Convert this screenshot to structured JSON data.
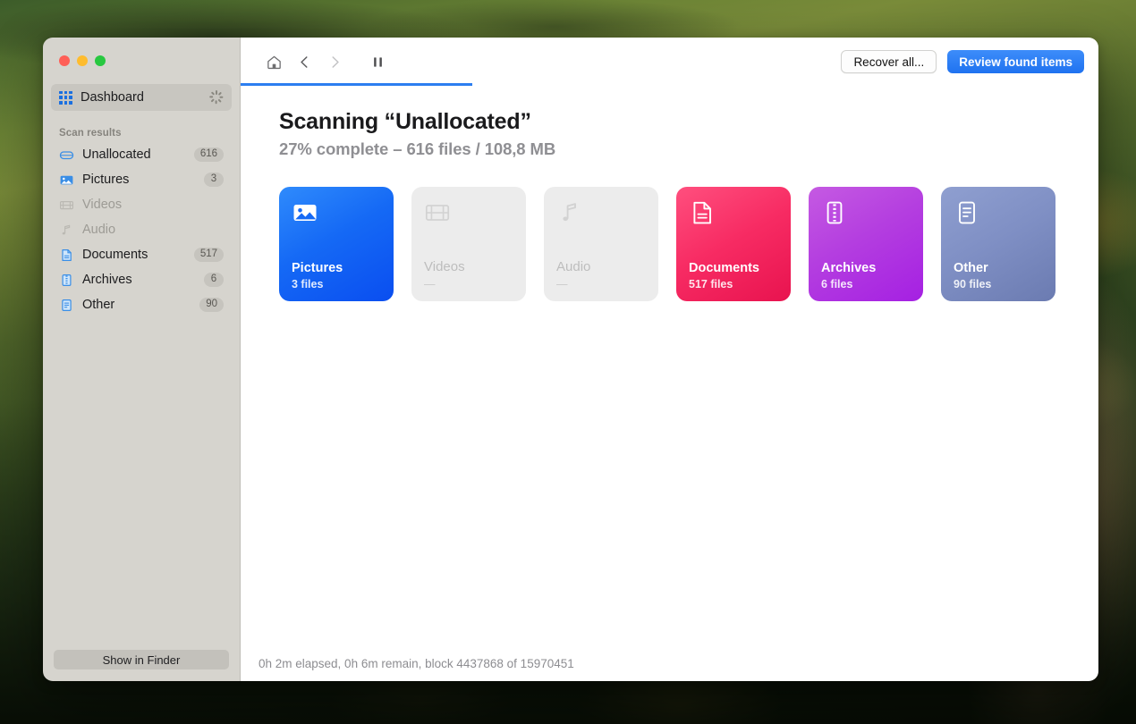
{
  "window": {
    "traffic_lights": [
      {
        "name": "close",
        "color": "#ff5f57"
      },
      {
        "name": "minimize",
        "color": "#febc2e"
      },
      {
        "name": "zoom",
        "color": "#28c840"
      }
    ]
  },
  "sidebar": {
    "dashboard": {
      "label": "Dashboard",
      "icon": "grid-icon",
      "busy_icon": "spinner-icon",
      "selected": true
    },
    "section_title": "Scan results",
    "items": [
      {
        "label": "Unallocated",
        "badge": "616",
        "icon": "disk-icon",
        "enabled": true
      },
      {
        "label": "Pictures",
        "badge": "3",
        "icon": "picture-icon",
        "enabled": true
      },
      {
        "label": "Videos",
        "badge": "",
        "icon": "film-icon",
        "enabled": false
      },
      {
        "label": "Audio",
        "badge": "",
        "icon": "note-icon",
        "enabled": false
      },
      {
        "label": "Documents",
        "badge": "517",
        "icon": "document-icon",
        "enabled": true
      },
      {
        "label": "Archives",
        "badge": "6",
        "icon": "archive-icon",
        "enabled": true
      },
      {
        "label": "Other",
        "badge": "90",
        "icon": "other-icon",
        "enabled": true
      }
    ],
    "show_in_finder_label": "Show in Finder"
  },
  "toolbar": {
    "home_icon": "home-icon",
    "back_icon": "chevron-left-icon",
    "forward_icon": "chevron-right-icon",
    "pause_icon": "pause-icon",
    "forward_enabled": false,
    "recover_all_label": "Recover all...",
    "review_found_label": "Review found items",
    "progress_percent": 27,
    "progress_color": "#2c7ef0"
  },
  "main": {
    "title": "Scanning “Unallocated”",
    "subtitle": "27% complete – 616 files / 108,8 MB",
    "tiles": [
      {
        "name": "Pictures",
        "count": "3 files",
        "icon": "picture-icon",
        "enabled": true,
        "color": "#1569f5"
      },
      {
        "name": "Videos",
        "count": "—",
        "icon": "film-icon",
        "enabled": false,
        "color": "#ececec"
      },
      {
        "name": "Audio",
        "count": "—",
        "icon": "note-icon",
        "enabled": false,
        "color": "#ececec"
      },
      {
        "name": "Documents",
        "count": "517 files",
        "icon": "document-icon",
        "enabled": true,
        "color": "#f72b63"
      },
      {
        "name": "Archives",
        "count": "6 files",
        "icon": "archive-icon",
        "enabled": true,
        "color": "#b43ee0"
      },
      {
        "name": "Other",
        "count": "90 files",
        "icon": "other-icon",
        "enabled": true,
        "color": "#7f8fc4"
      }
    ],
    "status": "0h 2m elapsed, 0h 6m remain, block 4437868 of 15970451"
  }
}
